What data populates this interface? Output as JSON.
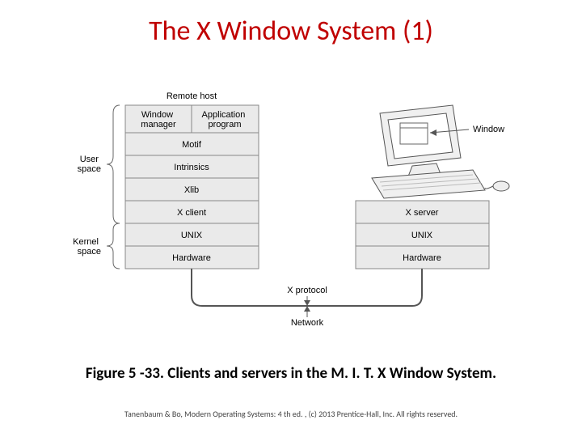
{
  "title": "The X Window System (1)",
  "caption": "Figure 5 -33. Clients and servers in the M. I. T. X Window System.",
  "footer": "Tanenbaum & Bo, Modern  Operating Systems: 4 th ed. , (c) 2013 Prentice-Hall, Inc. All rights reserved.",
  "diagram": {
    "remote_header": "Remote host",
    "left_stack": {
      "top_left": "Window\nmanager",
      "top_right": "Application\nprogram",
      "layers": [
        "Motif",
        "Intrinsics",
        "Xlib",
        "X client",
        "UNIX",
        "Hardware"
      ]
    },
    "right_stack": {
      "layers": [
        "X server",
        "UNIX",
        "Hardware"
      ]
    },
    "side_labels": {
      "user_space": "User\nspace",
      "kernel_space": "Kernel\nspace"
    },
    "arrows": {
      "window": "Window",
      "x_protocol": "X protocol",
      "network": "Network"
    }
  }
}
